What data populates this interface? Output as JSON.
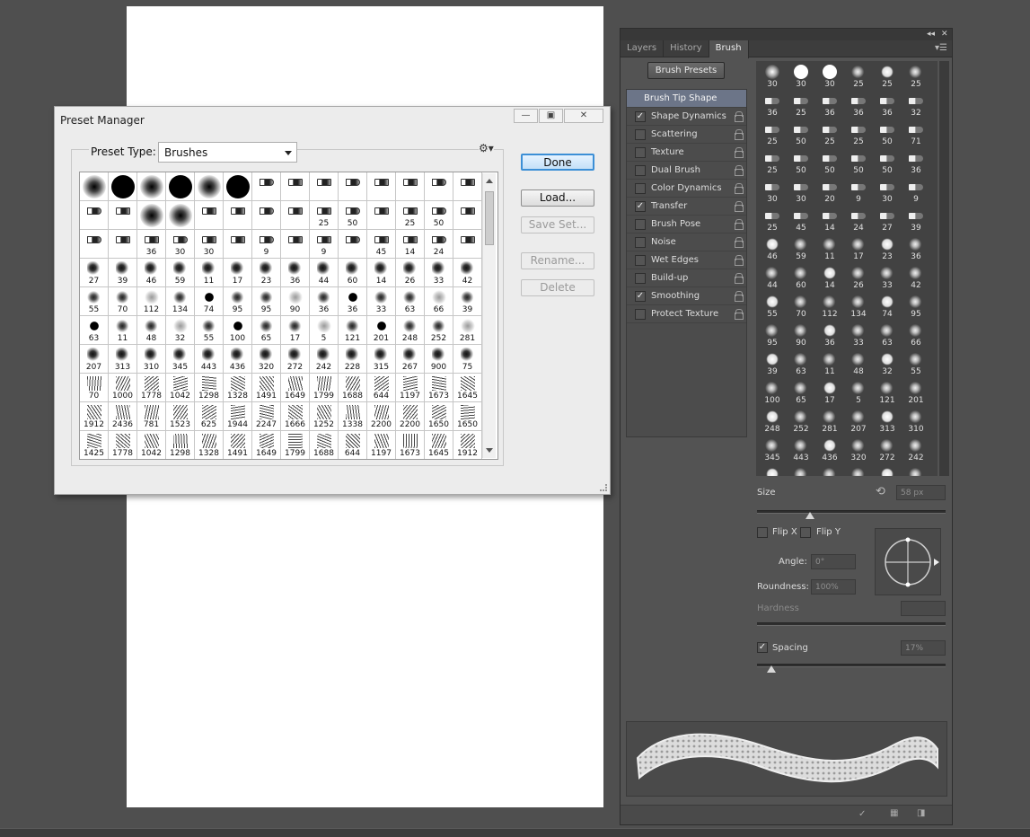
{
  "preset_manager": {
    "title": "Preset Manager",
    "preset_type_label": "Preset Type:",
    "preset_type_value": "Brushes",
    "buttons": {
      "done": "Done",
      "load": "Load...",
      "save_set": "Save Set...",
      "rename": "Rename...",
      "delete": "Delete"
    },
    "brush_grid": [
      "",
      "",
      "",
      "",
      "",
      "",
      "",
      "",
      "",
      "",
      "",
      "",
      "",
      "",
      "",
      "",
      "",
      "",
      "",
      "",
      "",
      "",
      "25",
      "50",
      "",
      "25",
      "50",
      "",
      "",
      "",
      "36",
      "30",
      "30",
      "",
      "9",
      "",
      "9",
      "",
      "45",
      "14",
      "24",
      "",
      "27",
      "39",
      "46",
      "59",
      "11",
      "17",
      "23",
      "36",
      "44",
      "60",
      "14",
      "26",
      "33",
      "42",
      "55",
      "70",
      "112",
      "134",
      "74",
      "95",
      "95",
      "90",
      "36",
      "36",
      "33",
      "63",
      "66",
      "39",
      "63",
      "11",
      "48",
      "32",
      "55",
      "100",
      "65",
      "17",
      "5",
      "121",
      "201",
      "248",
      "252",
      "281",
      "207",
      "313",
      "310",
      "345",
      "443",
      "436",
      "320",
      "272",
      "242",
      "228",
      "315",
      "267",
      "900",
      "75",
      "70",
      "1000",
      "1778",
      "1042",
      "1298",
      "1328",
      "1491",
      "1649",
      "1799",
      "1688",
      "644",
      "1197",
      "1673",
      "1645",
      "1912",
      "2436",
      "781",
      "1523",
      "625",
      "1944",
      "2247",
      "1666",
      "1252",
      "1338",
      "2200",
      "2200",
      "1650",
      "1650",
      "1425",
      "1778",
      "1042",
      "1298",
      "1328",
      "1491",
      "1649",
      "1799",
      "1688",
      "644",
      "1197",
      "1673",
      "1645",
      "1912"
    ]
  },
  "brush_panel": {
    "tabs": [
      "Layers",
      "History",
      "Brush"
    ],
    "brush_presets_button": "Brush Presets",
    "options": [
      {
        "label": "Brush Tip Shape",
        "checked": null
      },
      {
        "label": "Shape Dynamics",
        "checked": true
      },
      {
        "label": "Scattering",
        "checked": false
      },
      {
        "label": "Texture",
        "checked": false
      },
      {
        "label": "Dual Brush",
        "checked": false
      },
      {
        "label": "Color Dynamics",
        "checked": false
      },
      {
        "label": "Transfer",
        "checked": true
      },
      {
        "label": "Brush Pose",
        "checked": false
      },
      {
        "label": "Noise",
        "checked": false
      },
      {
        "label": "Wet Edges",
        "checked": false
      },
      {
        "label": "Build-up",
        "checked": false
      },
      {
        "label": "Smoothing",
        "checked": true
      },
      {
        "label": "Protect Texture",
        "checked": false
      }
    ],
    "tip_sizes": [
      "30",
      "30",
      "30",
      "25",
      "25",
      "25",
      "36",
      "25",
      "36",
      "36",
      "36",
      "32",
      "25",
      "50",
      "25",
      "25",
      "50",
      "71",
      "25",
      "50",
      "50",
      "50",
      "50",
      "36",
      "30",
      "30",
      "20",
      "9",
      "30",
      "9",
      "25",
      "45",
      "14",
      "24",
      "27",
      "39",
      "46",
      "59",
      "11",
      "17",
      "23",
      "36",
      "44",
      "60",
      "14",
      "26",
      "33",
      "42",
      "55",
      "70",
      "112",
      "134",
      "74",
      "95",
      "95",
      "90",
      "36",
      "33",
      "63",
      "66",
      "39",
      "63",
      "11",
      "48",
      "32",
      "55",
      "100",
      "65",
      "17",
      "5",
      "121",
      "201",
      "248",
      "252",
      "281",
      "207",
      "313",
      "310",
      "345",
      "443",
      "436",
      "320",
      "272",
      "242",
      "",
      "",
      "",
      "",
      "",
      ""
    ],
    "size_label": "Size",
    "size_value": "58 px",
    "flip_x": "Flip X",
    "flip_y": "Flip Y",
    "angle_label": "Angle:",
    "angle_value": "0°",
    "roundness_label": "Roundness:",
    "roundness_value": "100%",
    "hardness_label": "Hardness",
    "spacing_label": "Spacing",
    "spacing_value": "17%"
  }
}
